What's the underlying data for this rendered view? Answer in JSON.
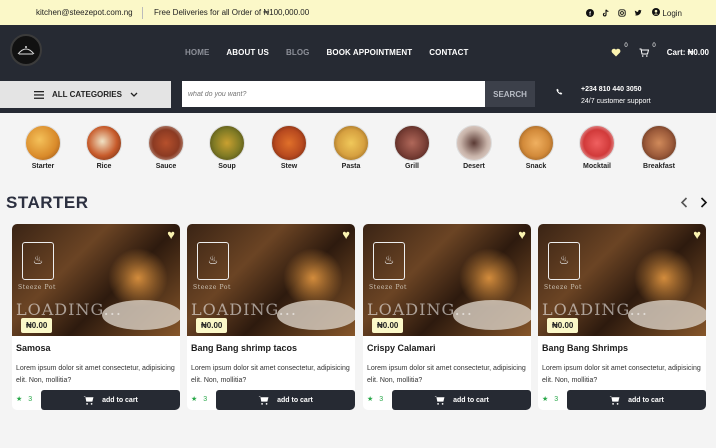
{
  "topbar": {
    "email": "kitchen@steezepot.com.ng",
    "promo": "Free Deliveries for all Order of ₦100,000.00",
    "login": "Login"
  },
  "nav": {
    "items": [
      "HOME",
      "ABOUT US",
      "BLOG",
      "BOOK APPOINTMENT",
      "CONTACT"
    ],
    "wishlist_count": "0",
    "cart_count": "0",
    "cart_label": "Cart: ₦0.00"
  },
  "search": {
    "categories_label": "ALL CATEGORIES",
    "placeholder": "what do you want?",
    "button": "SEARCH",
    "phone": "+234 810 440 3050",
    "support": "24/7 customer support"
  },
  "categories": [
    {
      "label": "Starter",
      "color": "#d98a2a"
    },
    {
      "label": "Rice",
      "color": "#c75b2b"
    },
    {
      "label": "Sauce",
      "color": "#8b3a22"
    },
    {
      "label": "Soup",
      "color": "#7f7a24"
    },
    {
      "label": "Stew",
      "color": "#b84a1f"
    },
    {
      "label": "Pasta",
      "color": "#d6a040"
    },
    {
      "label": "Grill",
      "color": "#7a3f36"
    },
    {
      "label": "Desert",
      "color": "#c7b2a8"
    },
    {
      "label": "Snack",
      "color": "#d28a3a"
    },
    {
      "label": "Mocktail",
      "color": "#d13a3a"
    },
    {
      "label": "Breakfast",
      "color": "#9b5a3a"
    }
  ],
  "section": {
    "title": "STARTER"
  },
  "products": [
    {
      "name": "Samosa",
      "price": "₦0.00",
      "desc": "Lorem ipsum dolor sit amet consectetur, adipisicing elit. Non, mollitia?",
      "rating": "3",
      "cta": "add to cart",
      "brand": "Steeze Pot",
      "overlay": "LOADING..."
    },
    {
      "name": "Bang Bang shrimp tacos",
      "price": "₦0.00",
      "desc": "Lorem ipsum dolor sit amet consectetur, adipisicing elit. Non, mollitia?",
      "rating": "3",
      "cta": "add to cart",
      "brand": "Steeze Pot",
      "overlay": "LOADING..."
    },
    {
      "name": "Crispy Calamari",
      "price": "₦0.00",
      "desc": "Lorem ipsum dolor sit amet consectetur, adipisicing elit. Non, mollitia?",
      "rating": "3",
      "cta": "add to cart",
      "brand": "Steeze Pot",
      "overlay": "LOADING..."
    },
    {
      "name": "Bang Bang Shrimps",
      "price": "₦0.00",
      "desc": "Lorem ipsum dolor sit amet consectetur, adipisicing elit. Non, mollitia?",
      "rating": "3",
      "cta": "add to cart",
      "brand": "Steeze Pot",
      "overlay": "LOADING..."
    }
  ],
  "colors": {
    "accent": "#fbf8c8",
    "dark": "#262a33",
    "rating": "#2aa84a"
  }
}
